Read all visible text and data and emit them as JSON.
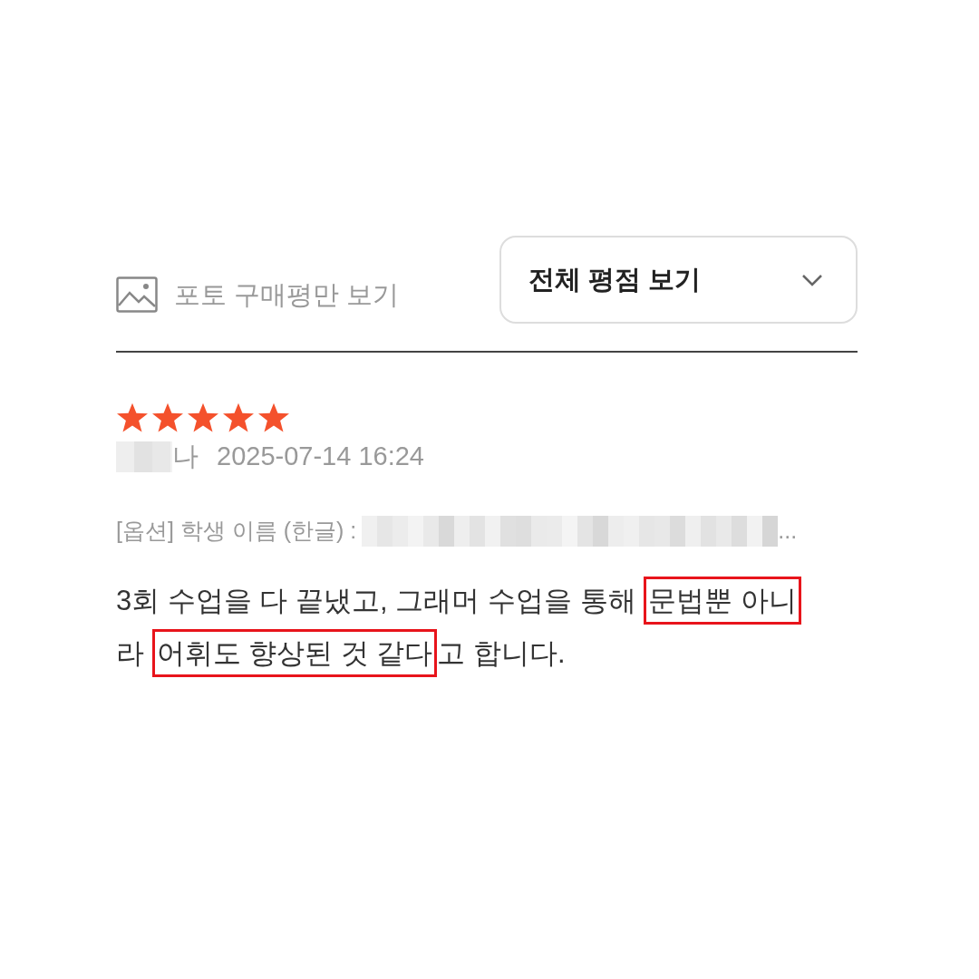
{
  "filters": {
    "photo_only": {
      "label": "포토 구매평만 보기",
      "checked": false
    },
    "rating_dropdown": {
      "label": "전체 평점 보기"
    }
  },
  "review": {
    "stars": 5,
    "reviewer_suffix": "나",
    "date": "2025-07-14 16:24",
    "option": {
      "label": "[옵션] 학생 이름 (한글) :",
      "value_tail": "..."
    },
    "lines": [
      [
        {
          "text": "3회 수업을 다 끝냈고, 그래머 수업을 통해 ",
          "highlighted": false
        },
        {
          "text": "문법뿐 아니",
          "highlighted": true
        }
      ],
      [
        {
          "text": "라 ",
          "highlighted": false
        },
        {
          "text": "어휘도 향상된 것 같다",
          "highlighted": true
        },
        {
          "text": "고 합니다.",
          "highlighted": false
        }
      ]
    ]
  }
}
